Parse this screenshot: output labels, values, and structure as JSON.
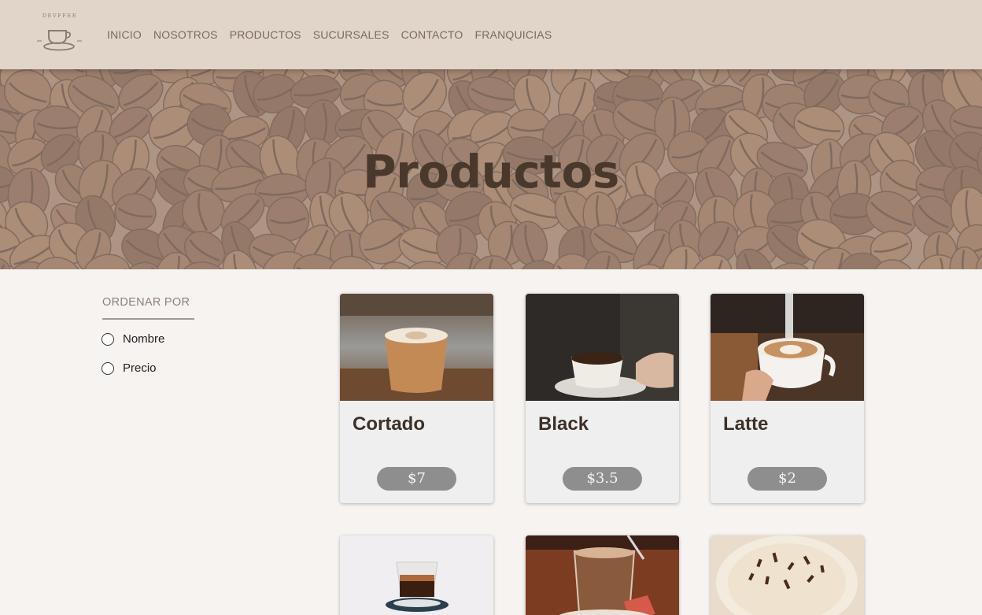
{
  "nav": {
    "logo_text": "DEVFFEE",
    "links": [
      "INICIO",
      "NOSOTROS",
      "PRODUCTOS",
      "SUCURSALES",
      "CONTACTO",
      "FRANQUICIAS"
    ]
  },
  "hero": {
    "title": "Productos"
  },
  "sort": {
    "title": "ORDENAR POR",
    "options": [
      "Nombre",
      "Precio"
    ]
  },
  "products": [
    {
      "name": "Cortado",
      "price": "$7"
    },
    {
      "name": "Black",
      "price": "$3.5"
    },
    {
      "name": "Latte",
      "price": "$2"
    }
  ],
  "colors": {
    "nav_bg": "#e1d4c8",
    "nav_text": "#7a6a5e",
    "page_bg": "#f7f3f1",
    "price_pill": "#8f8e8e",
    "title": "#4a382d"
  }
}
